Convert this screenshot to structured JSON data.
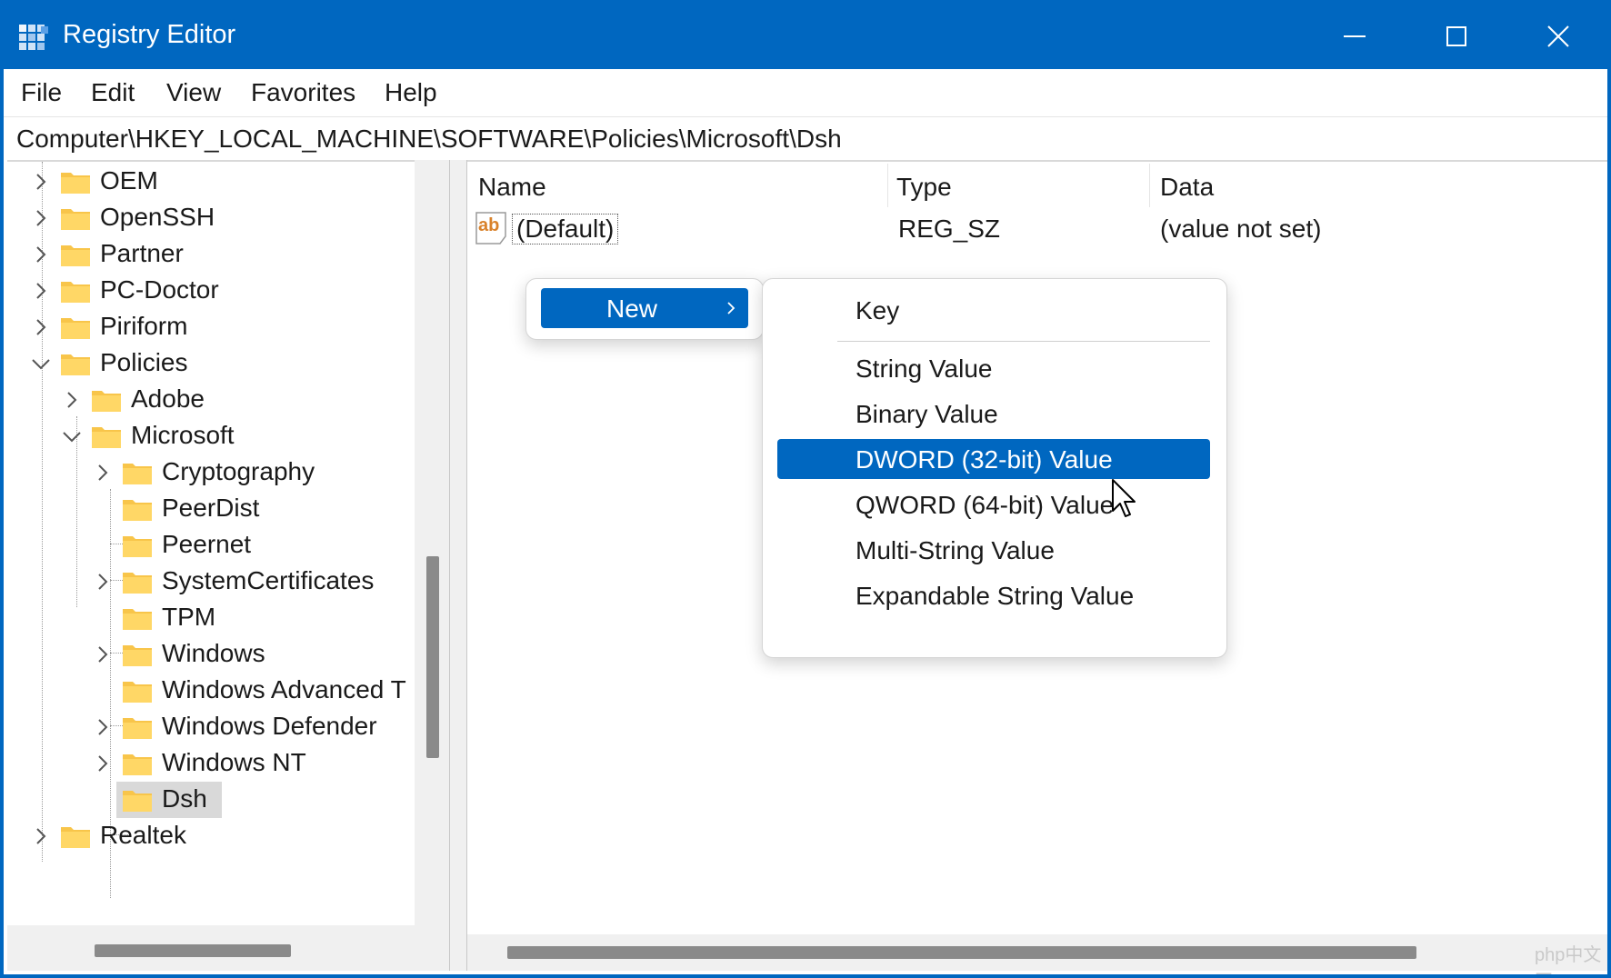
{
  "window": {
    "title": "Registry Editor",
    "accent_color": "#0067c0",
    "controls": [
      "minimize-icon",
      "maximize-icon",
      "close-icon"
    ]
  },
  "menu": {
    "file": "File",
    "edit": "Edit",
    "view": "View",
    "favorites": "Favorites",
    "help": "Help"
  },
  "address": {
    "path": "Computer\\HKEY_LOCAL_MACHINE\\SOFTWARE\\Policies\\Microsoft\\Dsh"
  },
  "tree": {
    "oem": "OEM",
    "openssh": "OpenSSH",
    "partner": "Partner",
    "pcdoctor": "PC-Doctor",
    "piriform": "Piriform",
    "policies": "Policies",
    "adobe": "Adobe",
    "microsoft": "Microsoft",
    "cryptography": "Cryptography",
    "peerdist": "PeerDist",
    "peernet": "Peernet",
    "systemcertificates": "SystemCertificates",
    "tpm": "TPM",
    "windows": "Windows",
    "windows_advanced": "Windows Advanced T",
    "windows_defender": "Windows Defender",
    "windows_nt": "Windows NT",
    "dsh": "Dsh",
    "realtek": "Realtek",
    "selected": "Dsh"
  },
  "list": {
    "columns": {
      "name": "Name",
      "type": "Type",
      "data": "Data"
    },
    "rows": [
      {
        "icon": "string-value-icon",
        "name": "(Default)",
        "type": "REG_SZ",
        "data": "(value not set)"
      }
    ]
  },
  "context_menu": {
    "new_label": "New",
    "submenu": {
      "key": "Key",
      "string": "String Value",
      "binary": "Binary Value",
      "dword": "DWORD (32-bit) Value",
      "qword": "QWORD (64-bit) Value",
      "multi": "Multi-String Value",
      "expandable": "Expandable String Value",
      "highlighted": "DWORD (32-bit) Value"
    }
  },
  "watermark": "php中文网"
}
